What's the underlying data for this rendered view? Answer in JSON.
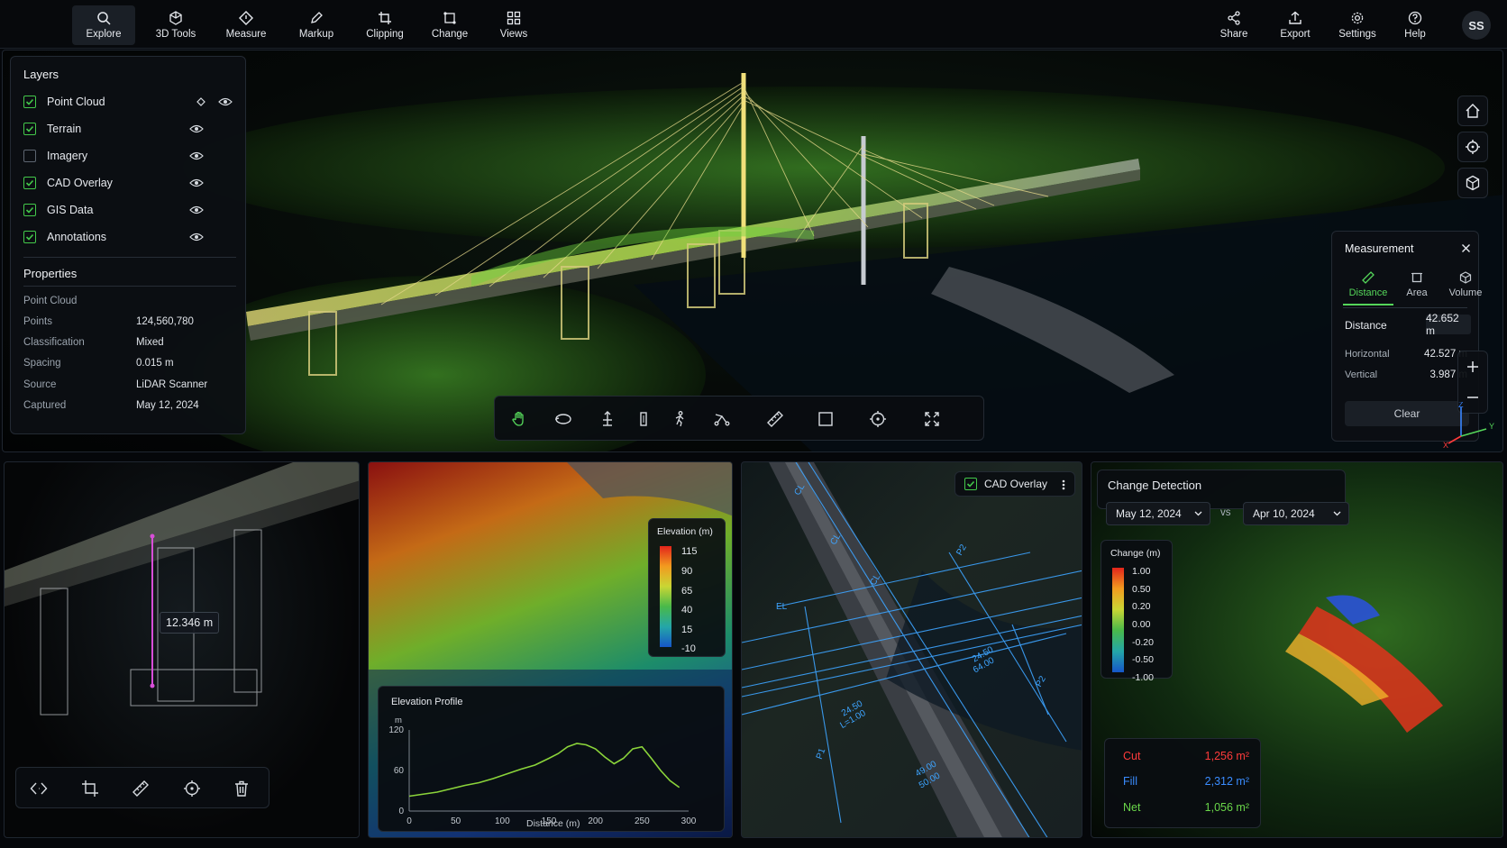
{
  "topbar": {
    "left_tools": [
      {
        "label": "Explore",
        "icon": "search-icon"
      },
      {
        "label": "3D Tools",
        "icon": "cube-icon"
      },
      {
        "label": "Measure",
        "icon": "diamond-icon"
      },
      {
        "label": "Markup",
        "icon": "pencil-icon"
      },
      {
        "label": "Clipping",
        "icon": "crop-icon"
      },
      {
        "label": "Change",
        "icon": "change-icon"
      },
      {
        "label": "Views",
        "icon": "grid-icon"
      }
    ],
    "right_tools": [
      {
        "label": "Share",
        "icon": "share-icon"
      },
      {
        "label": "Export",
        "icon": "upload-icon"
      },
      {
        "label": "Settings",
        "icon": "gear-icon"
      },
      {
        "label": "Help",
        "icon": "help-icon"
      }
    ],
    "avatar": "SS",
    "active_tool": "Explore"
  },
  "layers": {
    "title": "Layers",
    "items": [
      {
        "label": "Point Cloud",
        "checked": true
      },
      {
        "label": "Terrain",
        "checked": true
      },
      {
        "label": "Imagery",
        "checked": false
      },
      {
        "label": "CAD Overlay",
        "checked": true
      },
      {
        "label": "GIS Data",
        "checked": true
      },
      {
        "label": "Annotations",
        "checked": true
      }
    ]
  },
  "properties": {
    "title": "Properties",
    "subtitle": "Point Cloud",
    "rows": [
      {
        "key": "Points",
        "value": "124,560,780"
      },
      {
        "key": "Classification",
        "value": "Mixed"
      },
      {
        "key": "Spacing",
        "value": "0.015 m"
      },
      {
        "key": "Source",
        "value": "LiDAR Scanner"
      },
      {
        "key": "Captured",
        "value": "May 12, 2024"
      }
    ]
  },
  "measurement": {
    "title": "Measurement",
    "tabs": [
      {
        "label": "Distance",
        "icon": "ruler-icon"
      },
      {
        "label": "Area",
        "icon": "area-icon"
      },
      {
        "label": "Volume",
        "icon": "volume-icon"
      }
    ],
    "active_tab": "Distance",
    "distance_label": "Distance",
    "distance_value": "42.652 m",
    "horizontal_label": "Horizontal",
    "horizontal_value": "42.527 m",
    "vertical_label": "Vertical",
    "vertical_value": "3.987 m",
    "clear_label": "Clear"
  },
  "viewport_toolbar": [
    "hand-icon",
    "orbit-icon",
    "pan-icon",
    "height-icon",
    "walk-icon",
    "path-icon",
    "ruler-icon",
    "box-select-icon",
    "target-icon",
    "fullscreen-icon"
  ],
  "axis": {
    "x": "X",
    "y": "Y",
    "z": "Z"
  },
  "detail_view": {
    "measure_label": "12.346 m",
    "tools": [
      "code-icon",
      "crop-icon",
      "ruler-icon",
      "target-icon",
      "trash-icon"
    ]
  },
  "elevation": {
    "legend_title": "Elevation (m)",
    "legend_values": [
      "115",
      "90",
      "65",
      "40",
      "15",
      "-10"
    ],
    "profile_title": "Elevation Profile",
    "y_unit": "m",
    "xlabel": "Distance (m)"
  },
  "chart_data": {
    "type": "line",
    "title": "Elevation Profile",
    "xlabel": "Distance (m)",
    "ylabel": "m",
    "xlim": [
      0,
      300
    ],
    "ylim": [
      0,
      120
    ],
    "x_ticks": [
      "0",
      "50",
      "100",
      "150",
      "200",
      "250",
      "300"
    ],
    "y_ticks": [
      "120",
      "60",
      "0"
    ],
    "x": [
      0,
      15,
      30,
      45,
      60,
      75,
      90,
      105,
      120,
      135,
      150,
      160,
      170,
      180,
      190,
      200,
      210,
      220,
      230,
      240,
      250,
      260,
      270,
      280,
      290
    ],
    "y": [
      22,
      25,
      28,
      33,
      38,
      42,
      48,
      55,
      62,
      68,
      78,
      85,
      95,
      100,
      98,
      92,
      80,
      70,
      78,
      92,
      95,
      78,
      60,
      45,
      35
    ]
  },
  "cad": {
    "toggle_label": "CAD Overlay",
    "checked": true,
    "labels": [
      "CL",
      "CL",
      "CL",
      "EL",
      "P2",
      "P2",
      "P1",
      "24.50",
      "24.50",
      "49.00",
      "64.00",
      "50.00",
      "L=1.00"
    ]
  },
  "change_detection": {
    "title": "Change Detection",
    "date_a": "May 12, 2024",
    "vs": "vs",
    "date_b": "Apr 10, 2024",
    "legend_title": "Change (m)",
    "legend_values": [
      "1.00",
      "0.50",
      "0.20",
      "0.00",
      "-0.20",
      "-0.50",
      "-1.00"
    ],
    "summary": [
      {
        "label": "Cut",
        "value": "1,256 m²",
        "color": "#ff3b3b"
      },
      {
        "label": "Fill",
        "value": "2,312 m²",
        "color": "#3a8cff"
      },
      {
        "label": "Net",
        "value": "1,056 m²",
        "color": "#6ad74a"
      }
    ]
  }
}
